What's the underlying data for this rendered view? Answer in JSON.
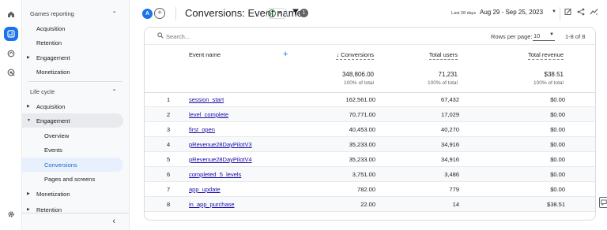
{
  "rail": {
    "icons": [
      "home-icon",
      "reports-icon",
      "explore-icon",
      "advertising-icon",
      "settings-icon"
    ]
  },
  "nav": {
    "games_reporting": "Games reporting",
    "gr_items": [
      "Acquisition",
      "Retention",
      "Engagement",
      "Monetization"
    ],
    "life_cycle": "Life cycle",
    "lc_acquisition": "Acquisition",
    "lc_engagement": "Engagement",
    "lc_sub": [
      "Overview",
      "Events",
      "Conversions",
      "Pages and screens"
    ],
    "lc_monetization": "Monetization",
    "lc_retention": "Retention",
    "collapse_glyph": "‹"
  },
  "header": {
    "avatar_letter": "A",
    "add_glyph": "+",
    "title": "Conversions: Event name",
    "filter_count": "1",
    "date_small": "Last 28 days",
    "date_range": "Aug 29 - Sep 25, 2023"
  },
  "toolbar": {
    "search_placeholder": "Search...",
    "rows_per_page_label": "Rows per page:",
    "rows_per_page_value": "10",
    "range": "1-8 of 8"
  },
  "table": {
    "headers": {
      "event_name": "Event name",
      "conversions": "↓ Conversions",
      "total_users": "Total users",
      "total_revenue": "Total revenue"
    },
    "totals": {
      "conversions": "348,806.00",
      "conversions_sub": "100% of total",
      "total_users": "71,231",
      "total_users_sub": "100% of total",
      "total_revenue": "$38.51",
      "total_revenue_sub": "100% of total"
    },
    "rows": [
      {
        "idx": "1",
        "name": "session_start",
        "conversions": "162,561.00",
        "users": "67,432",
        "revenue": "$0.00"
      },
      {
        "idx": "2",
        "name": "level_complete",
        "conversions": "70,771.00",
        "users": "17,029",
        "revenue": "$0.00"
      },
      {
        "idx": "3",
        "name": "first_open",
        "conversions": "40,453.00",
        "users": "40,270",
        "revenue": "$0.00"
      },
      {
        "idx": "4",
        "name": "pRevenue28DayPilotV3",
        "conversions": "35,233.00",
        "users": "34,916",
        "revenue": "$0.00"
      },
      {
        "idx": "5",
        "name": "pRevenue28DayPilotV4",
        "conversions": "35,233.00",
        "users": "34,916",
        "revenue": "$0.00"
      },
      {
        "idx": "6",
        "name": "completed_5_levels",
        "conversions": "3,751.00",
        "users": "3,486",
        "revenue": "$0.00"
      },
      {
        "idx": "7",
        "name": "app_update",
        "conversions": "782.00",
        "users": "779",
        "revenue": "$0.00"
      },
      {
        "idx": "8",
        "name": "in_app_purchase",
        "conversions": "22.00",
        "users": "14",
        "revenue": "$38.51"
      }
    ]
  },
  "colors": {
    "accent": "#1a73e8",
    "selected_bg": "#e8f0fe",
    "link": "#1a0dab",
    "success": "#188038"
  }
}
